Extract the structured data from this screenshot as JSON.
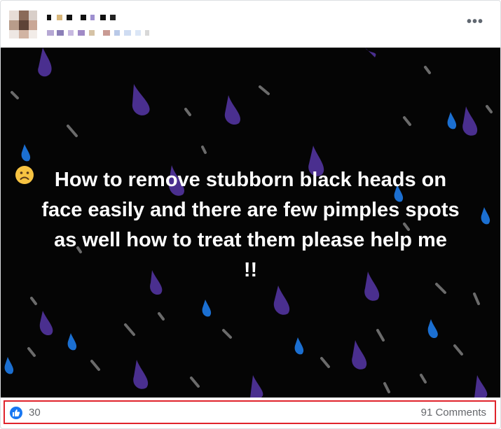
{
  "post": {
    "more_icon": "more-horizontal-icon",
    "text_line1": "How to remove stubborn black heads on",
    "text_line2": "face easily and there are few pimples spots",
    "text_line3a": "as well ",
    "text_line3b": "how to treat them please help me",
    "text_line4": "!!",
    "emoji_name": "frowning-face-emoji",
    "background": "black with purple and blue raindrops"
  },
  "reactions": {
    "icon": "like-icon",
    "count": "30",
    "comments": "91 Comments"
  },
  "colors": {
    "like_blue": "#1877f2",
    "highlight_red": "#e0232b",
    "drop_purple": "#4a2f8f",
    "drop_blue": "#1b6fd1",
    "drop_grey": "#6b6b6b"
  }
}
